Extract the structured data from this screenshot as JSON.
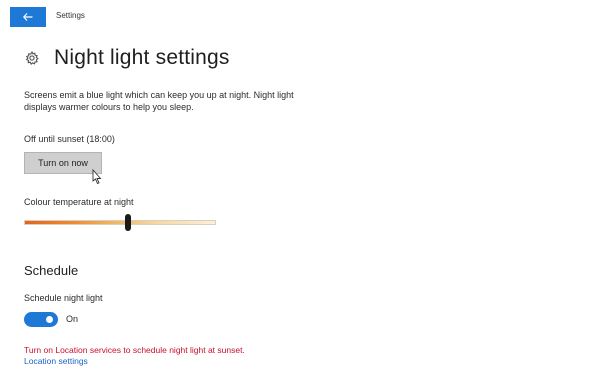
{
  "window": {
    "title": "Settings",
    "back_icon": "arrow-left-icon",
    "accent_color": "#1e78d6"
  },
  "header": {
    "icon": "gear-icon",
    "title": "Night light settings"
  },
  "description": "Screens emit a blue light which can keep you up at night. Night light displays warmer colours to help you sleep.",
  "status_text": "Off until sunset (18:00)",
  "turn_on_button": {
    "label": "Turn on now"
  },
  "colour_temperature": {
    "label": "Colour temperature at night",
    "value_percent": 54
  },
  "schedule": {
    "heading": "Schedule",
    "label": "Schedule night light",
    "toggle_state": "On",
    "toggle_on": true
  },
  "warning": {
    "text": "Turn on Location services to schedule night light at sunset.",
    "color": "#c8102e"
  },
  "location_link": {
    "text": "Location settings",
    "color": "#1e63c2"
  }
}
